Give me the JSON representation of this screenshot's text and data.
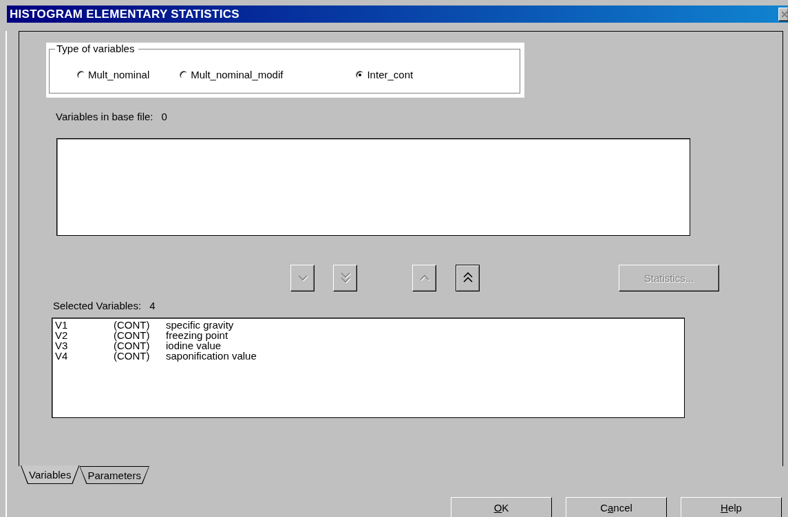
{
  "window": {
    "title": "HISTOGRAM ELEMENTARY STATISTICS"
  },
  "type_group": {
    "title": "Type of variables",
    "options": [
      {
        "label": "Mult_nominal",
        "selected": false
      },
      {
        "label": "Mult_nominal_modif",
        "selected": false
      },
      {
        "label": "Inter_cont",
        "selected": true
      }
    ]
  },
  "base_file": {
    "label": "Variables in base file:",
    "count": "0"
  },
  "move_buttons": [
    {
      "kind": "down",
      "disabled": true
    },
    {
      "kind": "down_all",
      "disabled": true
    },
    {
      "kind": "up",
      "disabled": true
    },
    {
      "kind": "up_all",
      "disabled": false
    }
  ],
  "statistics_button": {
    "label": "Statistics...",
    "disabled": true
  },
  "selected": {
    "label": "Selected Variables:",
    "count": "4",
    "rows": [
      {
        "id": "V1",
        "type": "(CONT)",
        "name": "specific gravity"
      },
      {
        "id": "V2",
        "type": "(CONT)",
        "name": "freezing point"
      },
      {
        "id": "V3",
        "type": "(CONT)",
        "name": "iodine value"
      },
      {
        "id": "V4",
        "type": "(CONT)",
        "name": "saponification value"
      }
    ]
  },
  "tabs": [
    {
      "label": "Variables",
      "selected": true
    },
    {
      "label": "Parameters",
      "selected": false
    }
  ],
  "buttons": [
    {
      "key": "O",
      "after": "K"
    },
    {
      "before": "C",
      "key": "a",
      "after": "ncel"
    },
    {
      "key": "H",
      "after": "elp"
    }
  ]
}
